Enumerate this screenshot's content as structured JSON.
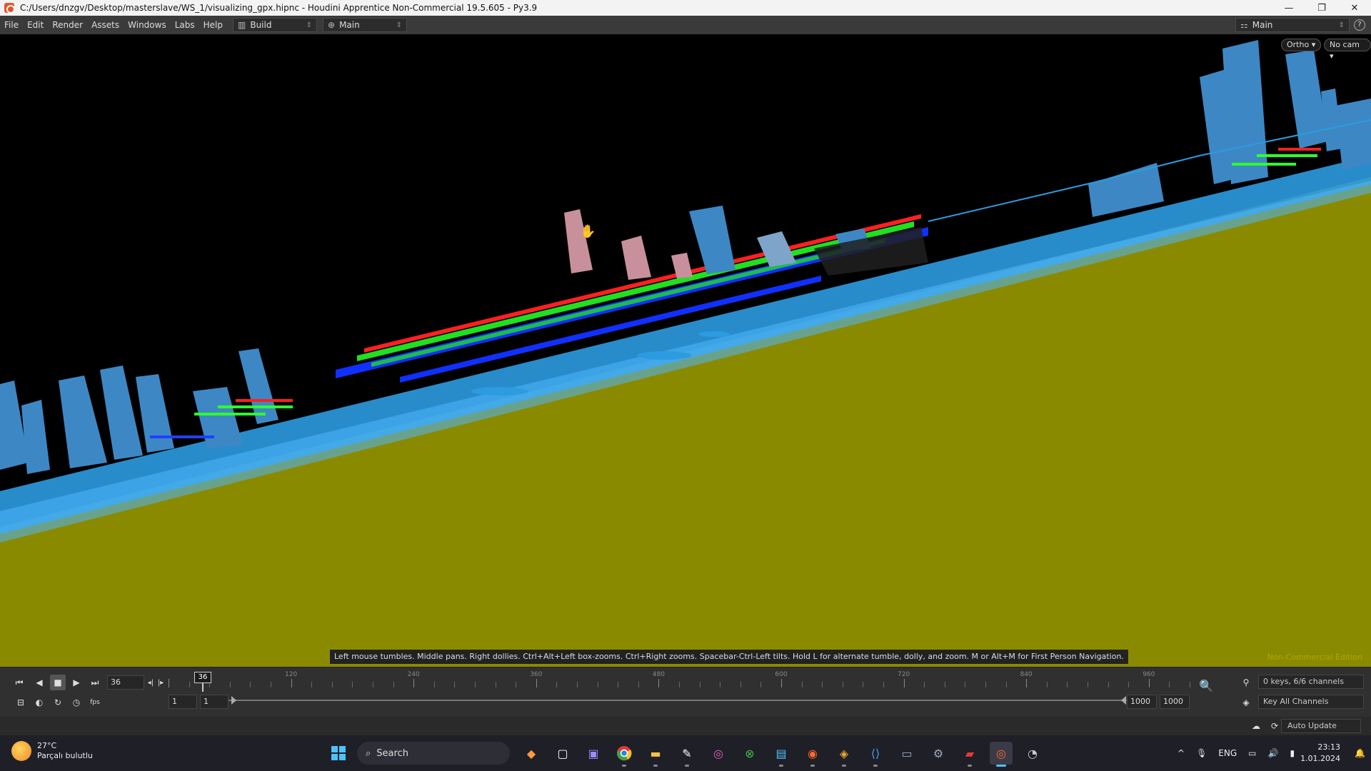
{
  "window": {
    "title": "C:/Users/dnzgv/Desktop/masterslave/WS_1/visualizing_gpx.hipnc - Houdini Apprentice Non-Commercial 19.5.605 - Py3.9",
    "minimize": "—",
    "maximize": "❐",
    "close": "✕"
  },
  "menubar": {
    "items": [
      "File",
      "Edit",
      "Render",
      "Assets",
      "Windows",
      "Labs",
      "Help"
    ],
    "desktop_left": "Build",
    "desktop_mid": "Main",
    "desktop_right": "Main"
  },
  "viewport": {
    "projection_button": "Ortho ▾",
    "camera_button": "No cam ▾",
    "hint": "Left mouse tumbles. Middle pans. Right dollies. Ctrl+Alt+Left box-zooms. Ctrl+Right zooms. Spacebar-Ctrl-Left tilts. Hold L for alternate tumble, dolly, and zoom.     M or Alt+M for First Person Navigation.",
    "edition": "Non-Commercial Edition",
    "colors": {
      "ground": "#8a8a00",
      "water": "#2d9be0",
      "sky": "#000000",
      "buildings": "#4a8fc4",
      "label_red": "#ff2020",
      "label_green": "#30ff30",
      "label_blue": "#2040ff"
    }
  },
  "timeline": {
    "current_frame": "36",
    "playhead_label": "36",
    "ruler_labels": [
      "120",
      "240",
      "360",
      "480",
      "600",
      "720",
      "840",
      "960"
    ],
    "range_start_a": "1",
    "range_start_b": "1",
    "range_end_a": "1000",
    "range_end_b": "1000",
    "keys_status": "0 keys, 6/6 channels",
    "key_all": "Key All Channels"
  },
  "status": {
    "auto_update": "Auto Update"
  },
  "taskbar": {
    "weather_temp": "27°C",
    "weather_desc": "Parçalı bulutlu",
    "search": "Search",
    "language": "ENG",
    "time": "23:13",
    "date": "1.01.2024"
  }
}
